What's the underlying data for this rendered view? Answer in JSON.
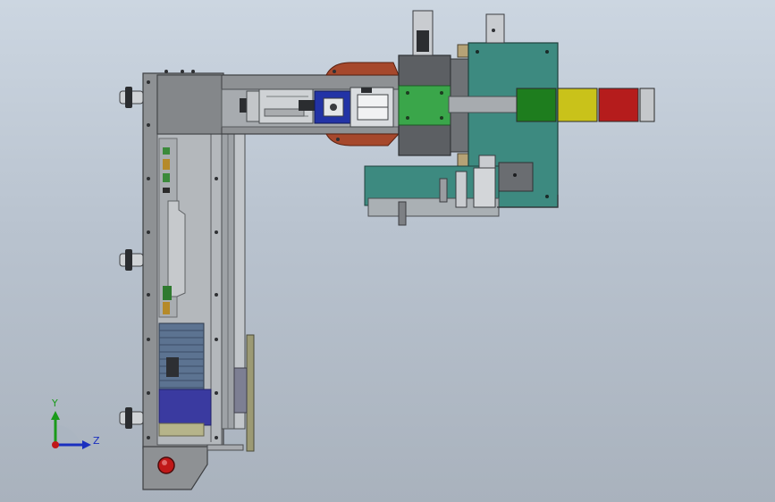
{
  "app": {
    "title": ""
  },
  "triad": {
    "y_label": "Y",
    "z_label": "Z",
    "colors": {
      "y": "#1a9a1a",
      "z": "#1a2fbf",
      "x": "#c01818"
    }
  },
  "model": {
    "signal_tower_segments": [
      {
        "name": "green-lamp",
        "color": "#1e7d1e"
      },
      {
        "name": "yellow-lamp",
        "color": "#c9c21a"
      },
      {
        "name": "red-lamp",
        "color": "#b51c1c"
      }
    ],
    "colors": {
      "frame": "#8d9093",
      "frame_dark": "#595c60",
      "panel_teal": "#3d8a80",
      "board_green": "#3aa64a",
      "motor_blue": "#2233a6",
      "copper": "#a6482c",
      "estop_red": "#c01818"
    }
  }
}
